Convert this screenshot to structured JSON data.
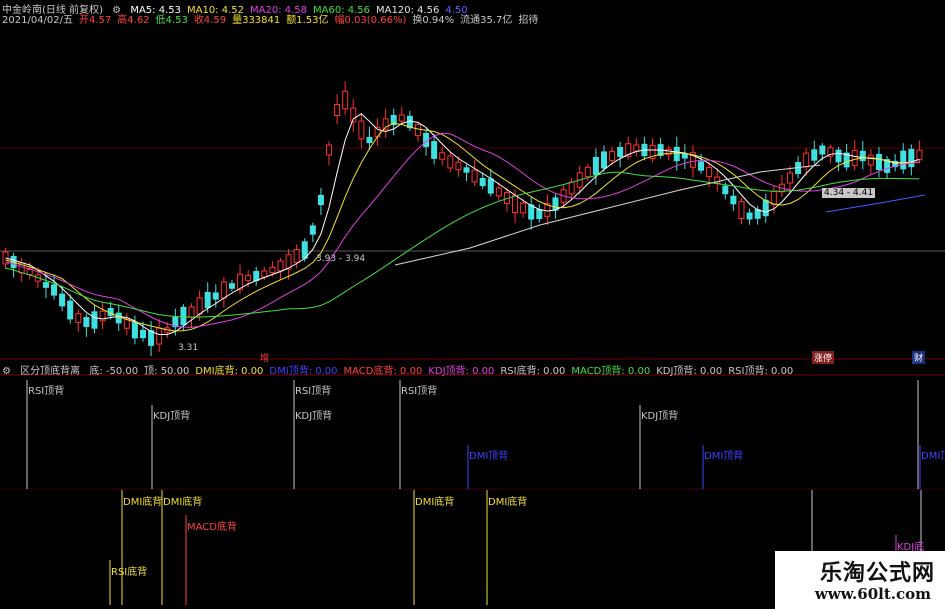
{
  "header": {
    "title": "中金岭南(日线 前复权)",
    "ma": [
      {
        "label": "MA5: 4.53",
        "color": "#ffffff"
      },
      {
        "label": "MA10: 4.52",
        "color": "#f0e030"
      },
      {
        "label": "MA20: 4.58",
        "color": "#e040e0"
      },
      {
        "label": "MA60: 4.56",
        "color": "#40e040"
      },
      {
        "label": "MA120: 4.56",
        "color": "#e0e0e0"
      },
      {
        "label": "4.50",
        "color": "#6060ff"
      }
    ],
    "quote": [
      {
        "label": "2021/04/02/五",
        "color": "#c8c8c8"
      },
      {
        "label": "开4.57",
        "color": "#ff4040"
      },
      {
        "label": "高4.62",
        "color": "#ff4040"
      },
      {
        "label": "低4.53",
        "color": "#40e040"
      },
      {
        "label": "收4.59",
        "color": "#ff4040"
      },
      {
        "label": "量333841",
        "color": "#f0e030"
      },
      {
        "label": "额1.53亿",
        "color": "#f0e030"
      },
      {
        "label": "幅0.03(0.66%)",
        "color": "#ff4040"
      },
      {
        "label": "换0.94%",
        "color": "#c8c8c8"
      },
      {
        "label": "流通35.7亿",
        "color": "#c8c8c8"
      },
      {
        "label": "招待",
        "color": "#c8c8c8"
      }
    ]
  },
  "price_labels": {
    "low": "3.31",
    "range1": "3.93 - 3.94",
    "range2": "4.34 - 4.41",
    "high_marker": "增",
    "event1": "涨停",
    "event2": "财"
  },
  "indicator": {
    "name": "区分顶底背离",
    "params": [
      {
        "label": "底: -50.00",
        "color": "#c8c8c8"
      },
      {
        "label": "顶: 50.00",
        "color": "#c8c8c8"
      },
      {
        "label": "DMI底背: 0.00",
        "color": "#f0e030"
      },
      {
        "label": "DMI顶背: 0.00",
        "color": "#4040ff"
      },
      {
        "label": "MACD底背: 0.00",
        "color": "#ff4040"
      },
      {
        "label": "KDJ顶背: 0.00",
        "color": "#e040e0"
      },
      {
        "label": "RSI底背: 0.00",
        "color": "#c8c8c8"
      },
      {
        "label": "MACD顶背: 0.00",
        "color": "#40e040"
      },
      {
        "label": "KDJ顶背: 0.00",
        "color": "#c8c8c8"
      },
      {
        "label": "RSI顶背: 0.00",
        "color": "#c8c8c8"
      }
    ]
  },
  "signals_top": [
    {
      "label": "RSI顶背",
      "color": "#c8c8c8"
    },
    {
      "label": "KDJ顶背",
      "color": "#c8c8c8"
    },
    {
      "label": "RSI顶背",
      "color": "#c8c8c8"
    },
    {
      "label": "KDJ顶背",
      "color": "#c8c8c8"
    },
    {
      "label": "RSI顶背",
      "color": "#c8c8c8"
    },
    {
      "label": "DMI顶背",
      "color": "#4040ff"
    },
    {
      "label": "KDJ顶背",
      "color": "#c8c8c8"
    },
    {
      "label": "DMI顶背",
      "color": "#4040ff"
    },
    {
      "label": "DMI顶",
      "color": "#4040ff"
    }
  ],
  "signals_bottom": [
    {
      "label": "DMI底背",
      "color": "#f0e030"
    },
    {
      "label": "DMI底背",
      "color": "#f0e030"
    },
    {
      "label": "MACD底背",
      "color": "#ff4040"
    },
    {
      "label": "RSI底背",
      "color": "#f0e030"
    },
    {
      "label": "DMI底背",
      "color": "#f0e030"
    },
    {
      "label": "DMI底背",
      "color": "#f0e030"
    },
    {
      "label": "KDJ底",
      "color": "#e040e0"
    }
  ],
  "watermark": {
    "name": "乐淘公式网",
    "url": "www.60lt.com"
  }
}
